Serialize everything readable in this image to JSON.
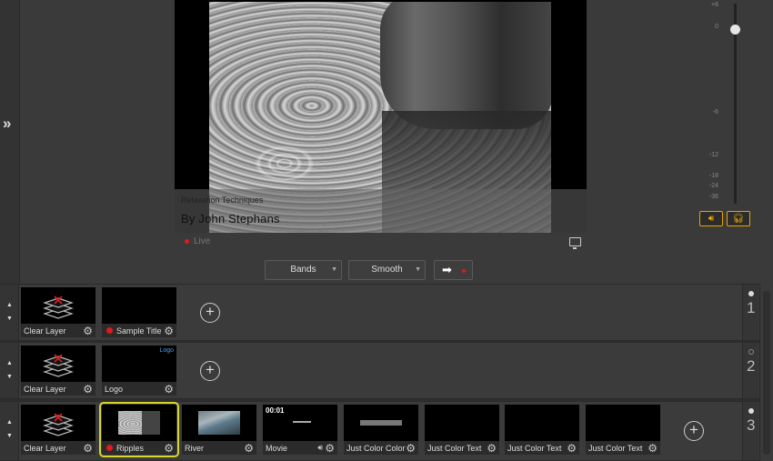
{
  "preview": {
    "lower_third_subtitle": "Relaxation Techniques",
    "lower_third_title": "By John Stephans",
    "live_label": "Live"
  },
  "transition": {
    "effect": "Bands",
    "effect2": "Smooth",
    "take_arrow": "➡"
  },
  "audio": {
    "ticks": [
      "+6",
      "0",
      "-6",
      "-12",
      "-18",
      "-24",
      "-36"
    ],
    "volume_db": 0,
    "speaker_icon": "speaker-icon",
    "headphones_icon": "headphones-icon",
    "accent": "#e8a400"
  },
  "layers": [
    {
      "number": "1",
      "active": true,
      "inputs": [
        {
          "label": "Clear Layer",
          "type": "clear"
        },
        {
          "label": "Sample Title",
          "type": "title",
          "live": true
        }
      ]
    },
    {
      "number": "2",
      "active": false,
      "inputs": [
        {
          "label": "Clear Layer",
          "type": "clear"
        },
        {
          "label": "Logo",
          "type": "logo",
          "overlay": "Logo"
        }
      ]
    },
    {
      "number": "3",
      "active": true,
      "inputs": [
        {
          "label": "Clear Layer",
          "type": "clear"
        },
        {
          "label": "Ripples",
          "type": "video",
          "live": true,
          "selected": true
        },
        {
          "label": "River",
          "type": "video"
        },
        {
          "label": "Movie",
          "type": "movie",
          "timecode": "00:01",
          "audio": true
        },
        {
          "label": "Just Color Color",
          "type": "color"
        },
        {
          "label": "Just Color Text",
          "type": "text"
        },
        {
          "label": "Just Color Text",
          "type": "text"
        },
        {
          "label": "Just Color Text",
          "type": "text"
        }
      ]
    }
  ],
  "colors": {
    "live_red": "#e01b1b",
    "selected_outline": "#d8d52b"
  }
}
